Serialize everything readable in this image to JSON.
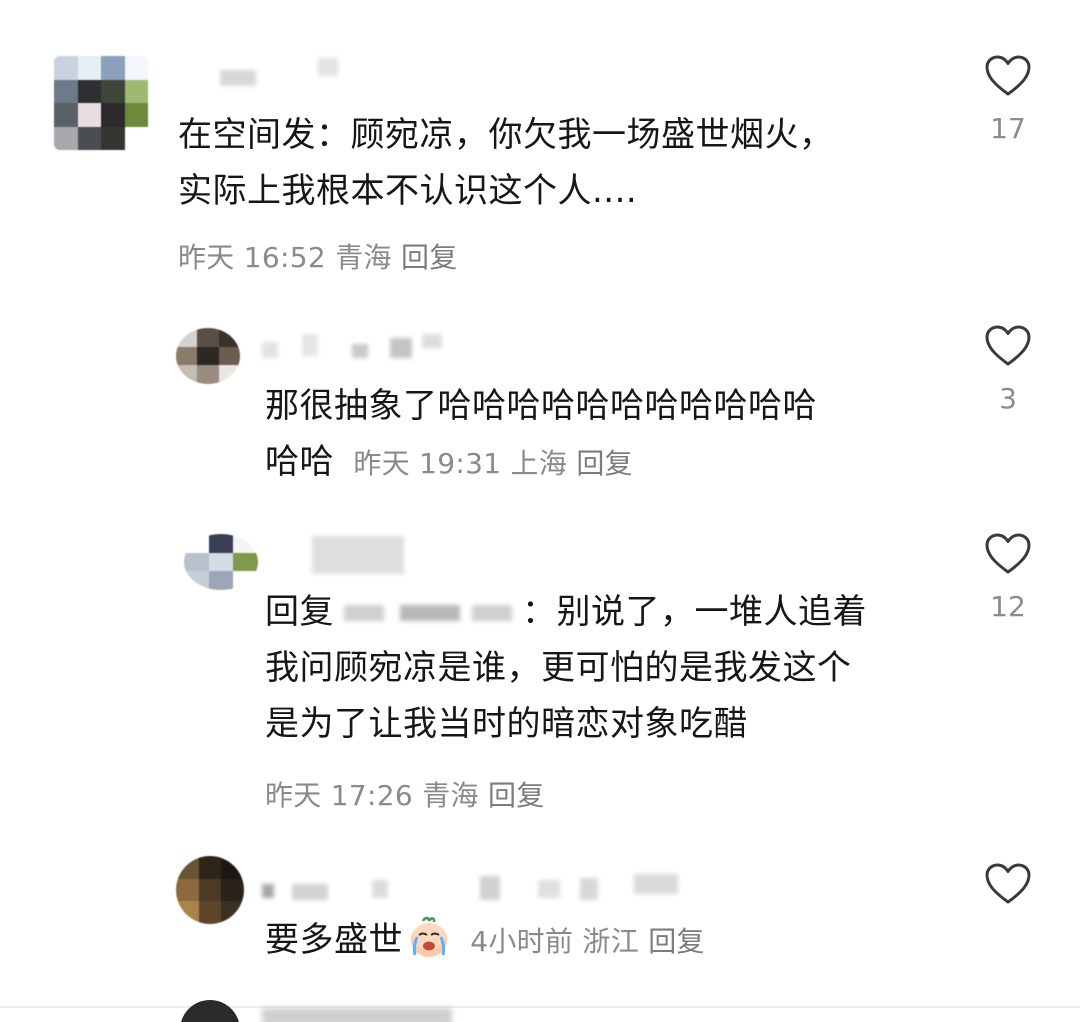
{
  "comments": [
    {
      "text_lines": [
        "在空间发：顾宛凉，你欠我一场盛世烟火，",
        "实际上我根本不认识这个人...."
      ],
      "time": "昨天 16:52",
      "location": "青海",
      "reply_label": "回复",
      "likes": "17"
    },
    {
      "text_lines": [
        "那很抽象了哈哈哈哈哈哈哈哈哈哈哈",
        "哈哈"
      ],
      "time": "昨天 19:31",
      "location": "上海",
      "reply_label": "回复",
      "likes": "3"
    },
    {
      "reply_prefix": "回复",
      "text_lines": [
        "：别说了，一堆人追着",
        "我问顾宛凉是谁，更可怕的是我发这个",
        "是为了让我当时的暗恋对象吃醋"
      ],
      "time": "昨天 17:26",
      "location": "青海",
      "reply_label": "回复",
      "likes": "12"
    },
    {
      "text_lines": [
        "要多盛世"
      ],
      "emoji": "crying-face-emoji",
      "time": "4小时前",
      "location": "浙江",
      "reply_label": "回复",
      "likes": ""
    }
  ],
  "colors": {
    "text": "#161616",
    "meta": "#8a8a8a",
    "heart_stroke": "#3a3a3a"
  },
  "icons": {
    "like": "heart-outline-icon"
  }
}
